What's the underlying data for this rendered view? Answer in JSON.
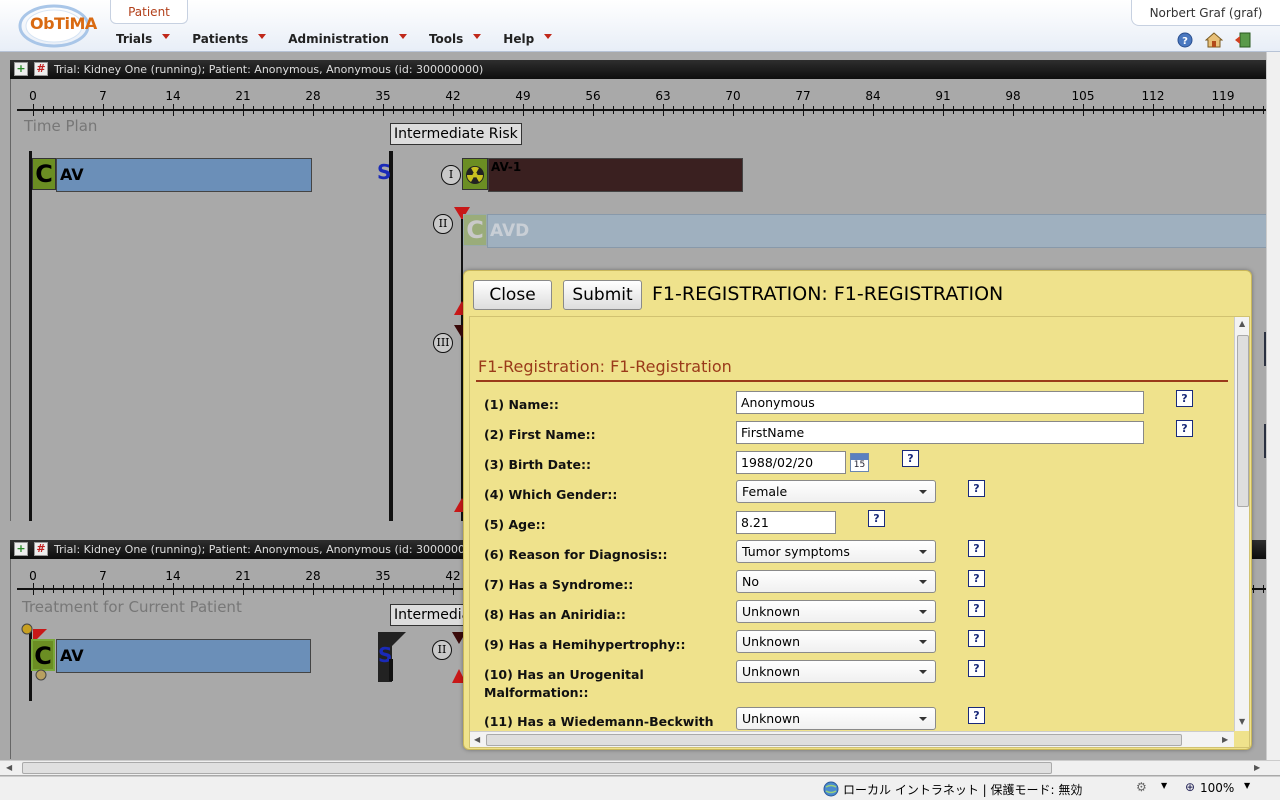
{
  "header": {
    "logo_text": "ObTiMA",
    "patient_tab": "Patient",
    "user": "Norbert Graf (graf)",
    "menu": [
      {
        "label": "Trials"
      },
      {
        "label": "Patients"
      },
      {
        "label": "Administration"
      },
      {
        "label": "Tools"
      },
      {
        "label": "Help"
      }
    ],
    "icons": [
      "help-icon",
      "home-icon",
      "logout-icon"
    ]
  },
  "panel_top": {
    "title": "Trial: Kidney One (running); Patient: Anonymous, Anonymous (id: 300000000)",
    "section_label": "Time Plan",
    "risk_label": "Intermediate Risk",
    "ticks": [
      "0",
      "7",
      "14",
      "21",
      "28",
      "35",
      "42",
      "49",
      "56",
      "63",
      "70",
      "77",
      "84",
      "91",
      "98",
      "105",
      "112",
      "119"
    ],
    "c_badge": "C",
    "av_label": "AV",
    "s_mark": "S",
    "arm_i": "I",
    "arm_ii": "II",
    "arm_iii": "III",
    "av1_label": "AV-1",
    "avd_c": "C",
    "avd_label": "AVD"
  },
  "panel_bottom": {
    "title": "Trial: Kidney One (running); Patient: Anonymous, Anonymous (id: 30000000",
    "section_label": "Treatment for Current Patient",
    "risk_label": "Intermediate Risk",
    "ticks": [
      "0",
      "7",
      "14",
      "21",
      "28",
      "35",
      "42"
    ],
    "c_badge": "C",
    "av_label": "AV",
    "s_mark": "S",
    "arm_ii": "II"
  },
  "modal": {
    "close_label": "Close",
    "submit_label": "Submit",
    "title": "F1-REGISTRATION: F1-REGISTRATION",
    "form_heading": "F1-Registration: F1-Registration",
    "help_label": "?",
    "fields": [
      {
        "label": "(1) Name::",
        "kind": "text",
        "value": "Anonymous"
      },
      {
        "label": "(2) First Name::",
        "kind": "text",
        "value": "FirstName"
      },
      {
        "label": "(3) Birth Date::",
        "kind": "date",
        "value": "1988/02/20",
        "calendar_day": "15"
      },
      {
        "label": "(4) Which Gender::",
        "kind": "select",
        "value": "Female"
      },
      {
        "label": "(5) Age::",
        "kind": "text",
        "value": "8.21"
      },
      {
        "label": "(6) Reason for Diagnosis::",
        "kind": "select",
        "value": "Tumor symptoms"
      },
      {
        "label": "(7) Has a Syndrome::",
        "kind": "select",
        "value": "No"
      },
      {
        "label": "(8) Has an Aniridia::",
        "kind": "select",
        "value": "Unknown"
      },
      {
        "label": "(9) Has a Hemihypertrophy::",
        "kind": "select",
        "value": "Unknown"
      },
      {
        "label": "(10) Has an Urogenital Malformation::",
        "kind": "select",
        "value": "Unknown"
      },
      {
        "label": "(11) Has a Wiedemann-Beckwith",
        "kind": "select",
        "value": "Unknown"
      }
    ]
  },
  "statusbar": {
    "zone": "ローカル イントラネット | 保護モード: 無効",
    "zoom": "100%"
  },
  "colors": {
    "brand_orange": "#d96a12",
    "menu_caret": "#c0281a",
    "modal_bg": "#efe28c",
    "av_bar": "#6b8fb8",
    "av1_bar": "#3a2020",
    "avd_bar": "#9fb0bf",
    "c_badge": "#6b8e23",
    "s_mark": "#1a2ab8",
    "heading_red": "#9a3a1a"
  }
}
